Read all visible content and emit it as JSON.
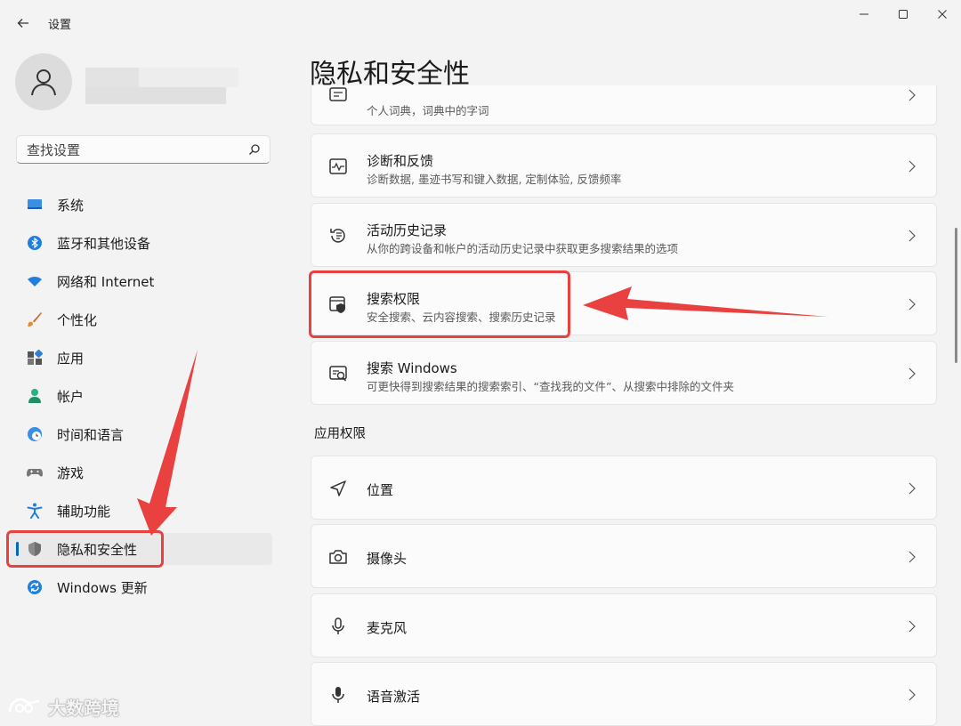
{
  "app": {
    "title": "设置"
  },
  "search": {
    "placeholder": "查找设置"
  },
  "nav": {
    "items": [
      {
        "label": "系统"
      },
      {
        "label": "蓝牙和其他设备"
      },
      {
        "label": "网络和 Internet"
      },
      {
        "label": "个性化"
      },
      {
        "label": "应用"
      },
      {
        "label": "帐户"
      },
      {
        "label": "时间和语言"
      },
      {
        "label": "游戏"
      },
      {
        "label": "辅助功能"
      },
      {
        "label": "隐私和安全性"
      },
      {
        "label": "Windows 更新"
      }
    ],
    "selected": "隐私和安全性"
  },
  "main": {
    "title": "隐私和安全性",
    "cards": [
      {
        "title": "",
        "subtitle": "个人词典，词典中的字词",
        "icon": "dictionary-icon"
      },
      {
        "title": "诊断和反馈",
        "subtitle": "诊断数据, 墨迹书写和键入数据, 定制体验, 反馈频率",
        "icon": "diagnostics-icon"
      },
      {
        "title": "活动历史记录",
        "subtitle": "从你的跨设备和帐户的活动历史记录中获取更多搜索结果的选项",
        "icon": "history-icon"
      },
      {
        "title": "搜索权限",
        "subtitle": "安全搜索、云内容搜索、搜索历史记录",
        "icon": "search-permission-icon"
      },
      {
        "title": "搜索 Windows",
        "subtitle": "可更快得到搜索结果的搜索索引、“查找我的文件”、从搜索中排除的文件夹",
        "icon": "search-windows-icon"
      }
    ],
    "section_title": "应用权限",
    "app_permissions": [
      {
        "title": "位置",
        "icon": "location-icon"
      },
      {
        "title": "摄像头",
        "icon": "camera-icon"
      },
      {
        "title": "麦克风",
        "icon": "microphone-icon"
      },
      {
        "title": "语音激活",
        "icon": "voice-activation-icon"
      }
    ]
  },
  "watermark": {
    "text": "大数跨境"
  },
  "colors": {
    "accent": "#0067c0",
    "annotation": "#e8413f",
    "background": "#f3f3f3",
    "card": "#fbfbfb"
  }
}
